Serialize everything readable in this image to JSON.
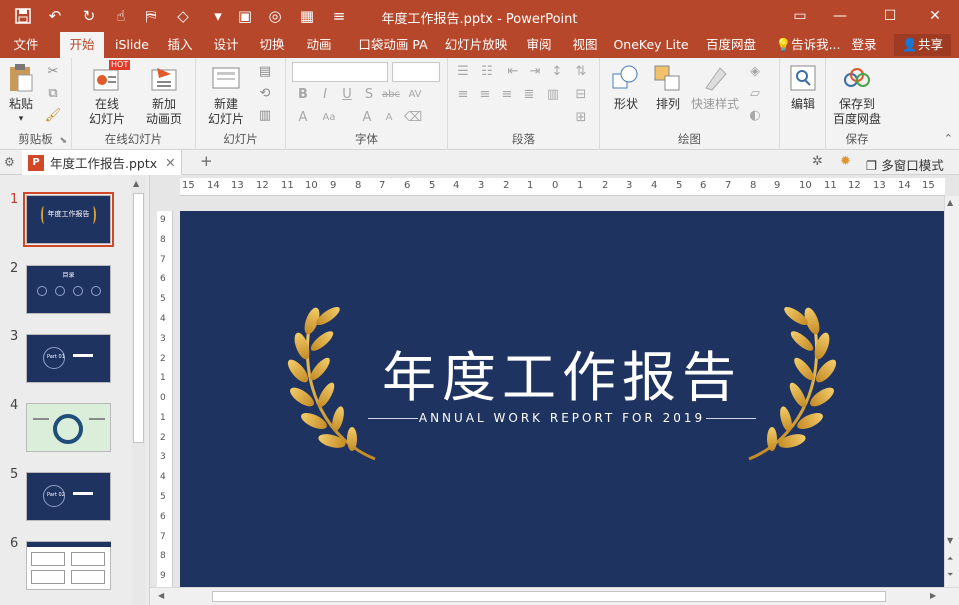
{
  "app": {
    "title": "年度工作报告.pptx - PowerPoint",
    "brand_color": "#b7472a"
  },
  "quick_access": [
    "save-icon",
    "undo-icon",
    "redo-icon",
    "touch-mode-icon",
    "format-painter-icon",
    "shapes-icon",
    "more-icon",
    "image-icon",
    "camera-icon",
    "grid-icon",
    "customize-icon"
  ],
  "tabs": [
    {
      "label": "文件"
    },
    {
      "label": "开始"
    },
    {
      "label": "iSlide"
    },
    {
      "label": "插入"
    },
    {
      "label": "设计"
    },
    {
      "label": "切换"
    },
    {
      "label": "动画"
    },
    {
      "label": "口袋动画 PA"
    },
    {
      "label": "幻灯片放映"
    },
    {
      "label": "审阅"
    },
    {
      "label": "视图"
    },
    {
      "label": "OneKey Lite"
    },
    {
      "label": "百度网盘"
    }
  ],
  "active_tab": "开始",
  "tell_me": "告诉我...",
  "login": "登录",
  "share": "共享",
  "ribbon": {
    "clipboard": {
      "label": "剪贴板",
      "paste": "粘贴"
    },
    "online_slides": {
      "label": "在线幻灯片",
      "online": "在线\n幻灯片",
      "new_anim": "新加\n动画页",
      "hot": "HOT"
    },
    "slides": {
      "label": "幻灯片",
      "new_slide": "新建\n幻灯片"
    },
    "font": {
      "label": "字体"
    },
    "paragraph": {
      "label": "段落"
    },
    "drawing": {
      "label": "绘图",
      "shape": "形状",
      "arrange": "排列",
      "quick_styles": "快速样式"
    },
    "editing": {
      "label": "编辑",
      "edit": "编辑"
    },
    "save": {
      "label": "保存",
      "save_to": "保存到\n百度网盘"
    }
  },
  "document": {
    "tab_name": "年度工作报告.pptx",
    "multi_window": "多窗口模式"
  },
  "thumbnails": [
    {
      "num": "1",
      "title": "年度工作报告"
    },
    {
      "num": "2",
      "title": "目录"
    },
    {
      "num": "3",
      "title": "Part 01"
    },
    {
      "num": "4",
      "title": ""
    },
    {
      "num": "5",
      "title": "Part 02"
    },
    {
      "num": "6",
      "title": ""
    }
  ],
  "ruler": {
    "h_labels": [
      "15",
      "14",
      "13",
      "12",
      "11",
      "10",
      "9",
      "8",
      "7",
      "6",
      "5",
      "4",
      "3",
      "2",
      "1",
      "0",
      "1",
      "2",
      "3",
      "4",
      "5",
      "6",
      "7",
      "8",
      "9",
      "10",
      "11",
      "12",
      "13",
      "14",
      "15"
    ],
    "v_labels": [
      "9",
      "8",
      "7",
      "6",
      "5",
      "4",
      "3",
      "2",
      "1",
      "0",
      "1",
      "2",
      "3",
      "4",
      "5",
      "6",
      "7",
      "8",
      "9"
    ]
  },
  "slide": {
    "title": "年度工作报告",
    "subtitle": "ANNUAL WORK REPORT FOR 2019",
    "background": "#1f3360",
    "accent": "#d4a13a"
  }
}
